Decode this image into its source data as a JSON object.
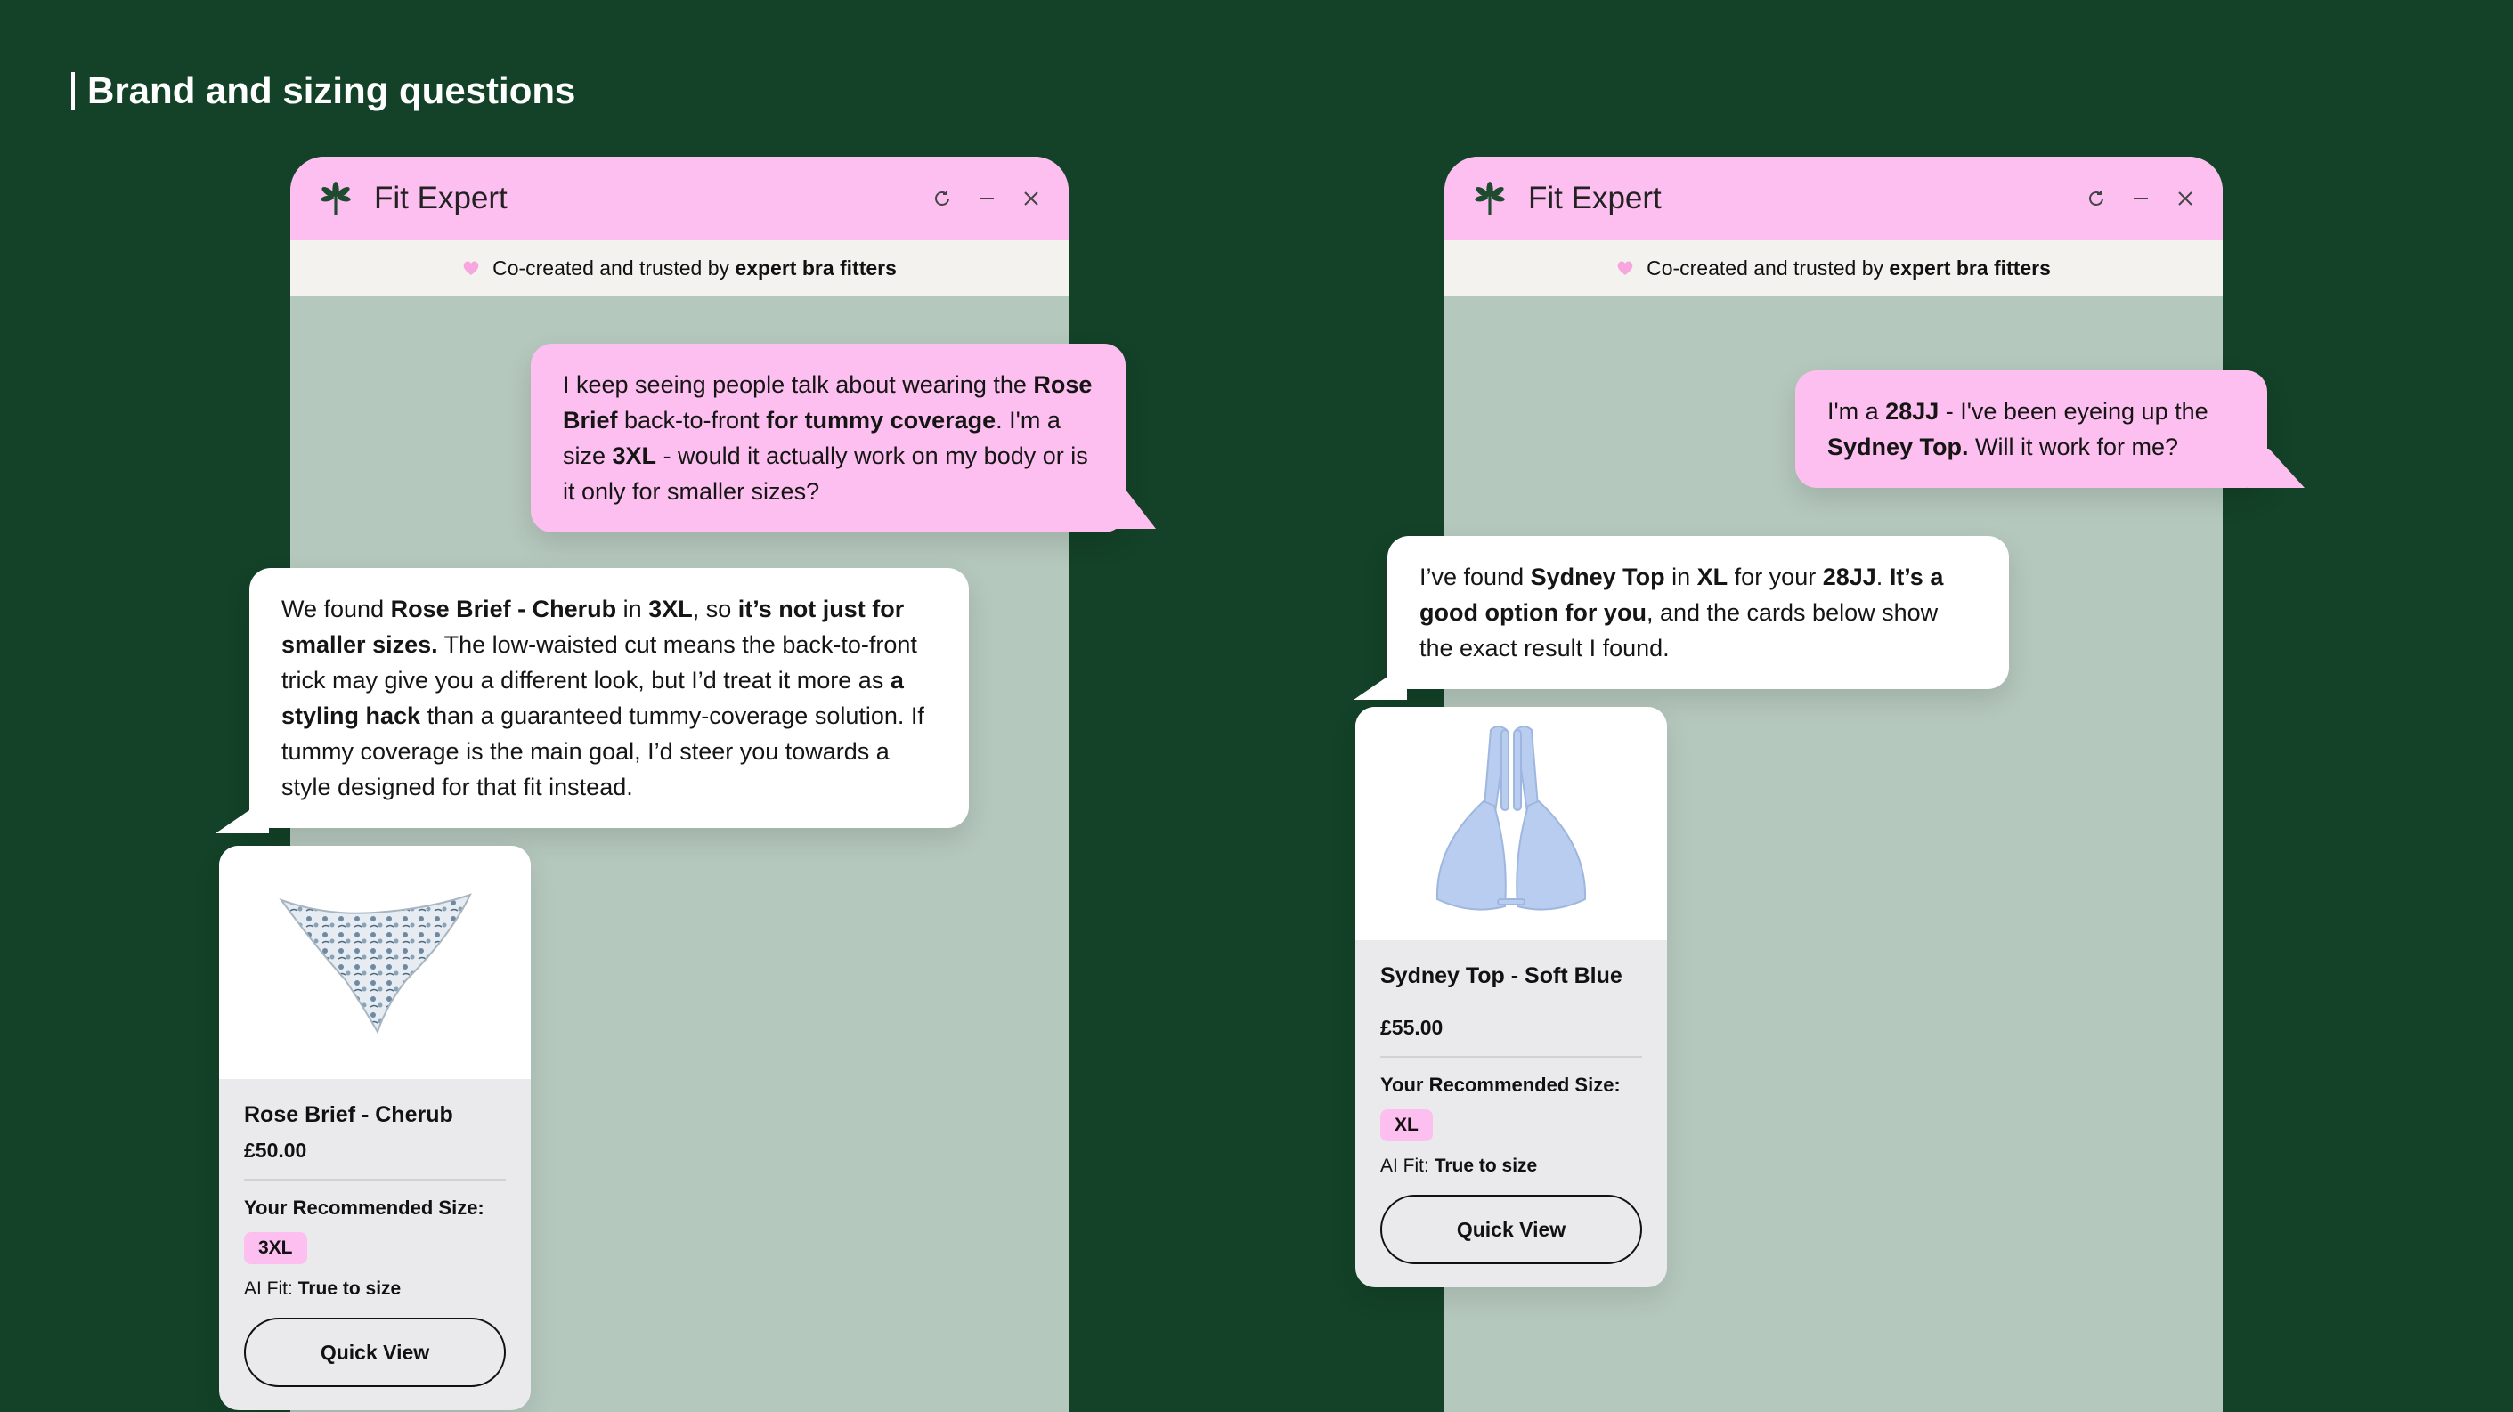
{
  "slide": {
    "title": "Brand and sizing questions"
  },
  "widget": {
    "title": "Fit Expert",
    "subtitle_prefix": "Co-created and trusted by",
    "subtitle_bold": "expert bra fitters",
    "icons": [
      "palm-logo-icon",
      "refresh-icon",
      "minimize-icon",
      "close-icon",
      "heart-icon"
    ]
  },
  "left": {
    "user_message": [
      {
        "t": "I keep seeing people talk about wearing the ",
        "b": false
      },
      {
        "t": "Rose Brief",
        "b": true
      },
      {
        "t": " back-to-front ",
        "b": false
      },
      {
        "t": "for tummy coverage",
        "b": true
      },
      {
        "t": ". I'm a size ",
        "b": false
      },
      {
        "t": "3XL",
        "b": true
      },
      {
        "t": " - would it actually work on my body or is it only for smaller sizes?",
        "b": false
      }
    ],
    "bot_message": [
      {
        "t": "We found ",
        "b": false
      },
      {
        "t": "Rose Brief - Cherub",
        "b": true
      },
      {
        "t": " in ",
        "b": false
      },
      {
        "t": "3XL",
        "b": true
      },
      {
        "t": ", so ",
        "b": false
      },
      {
        "t": "it’s not just for smaller sizes.",
        "b": true
      },
      {
        "t": " The low-waisted cut means the back-to-front trick may give you a different look, but I’d treat it more as ",
        "b": false
      },
      {
        "t": "a styling hack",
        "b": true
      },
      {
        "t": " than a guaranteed tummy-coverage solution. If tummy coverage is the main goal, I’d steer you towards a style designed for that fit instead.",
        "b": false
      }
    ],
    "card": {
      "name": "Rose Brief - Cherub",
      "price": "£50.00",
      "rec_label": "Your Recommended Size:",
      "size": "3XL",
      "fit_label": "AI Fit: ",
      "fit_value": "True to size",
      "button": "Quick View"
    }
  },
  "right": {
    "user_message": [
      {
        "t": "I'm a ",
        "b": false
      },
      {
        "t": "28JJ",
        "b": true
      },
      {
        "t": " - I've been eyeing up the ",
        "b": false
      },
      {
        "t": "Sydney Top.",
        "b": true
      },
      {
        "t": " Will it work for me?",
        "b": false
      }
    ],
    "bot_message": [
      {
        "t": "I’ve found ",
        "b": false
      },
      {
        "t": "Sydney Top",
        "b": true
      },
      {
        "t": " in ",
        "b": false
      },
      {
        "t": "XL",
        "b": true
      },
      {
        "t": " for your ",
        "b": false
      },
      {
        "t": "28JJ",
        "b": true
      },
      {
        "t": ". ",
        "b": false
      },
      {
        "t": "It’s a good option for you",
        "b": true
      },
      {
        "t": ", and the cards below show the exact result I found.",
        "b": false
      }
    ],
    "card": {
      "name": "Sydney Top - Soft Blue",
      "price": "£55.00",
      "rec_label": "Your Recommended Size:",
      "size": "XL",
      "fit_label": "AI Fit: ",
      "fit_value": "True to size",
      "button": "Quick View"
    }
  },
  "colors": {
    "background": "#134228",
    "header_pink": "#fcbfef",
    "chat_bg": "#b5c8bd",
    "banner_bg": "#f4f2ef"
  }
}
